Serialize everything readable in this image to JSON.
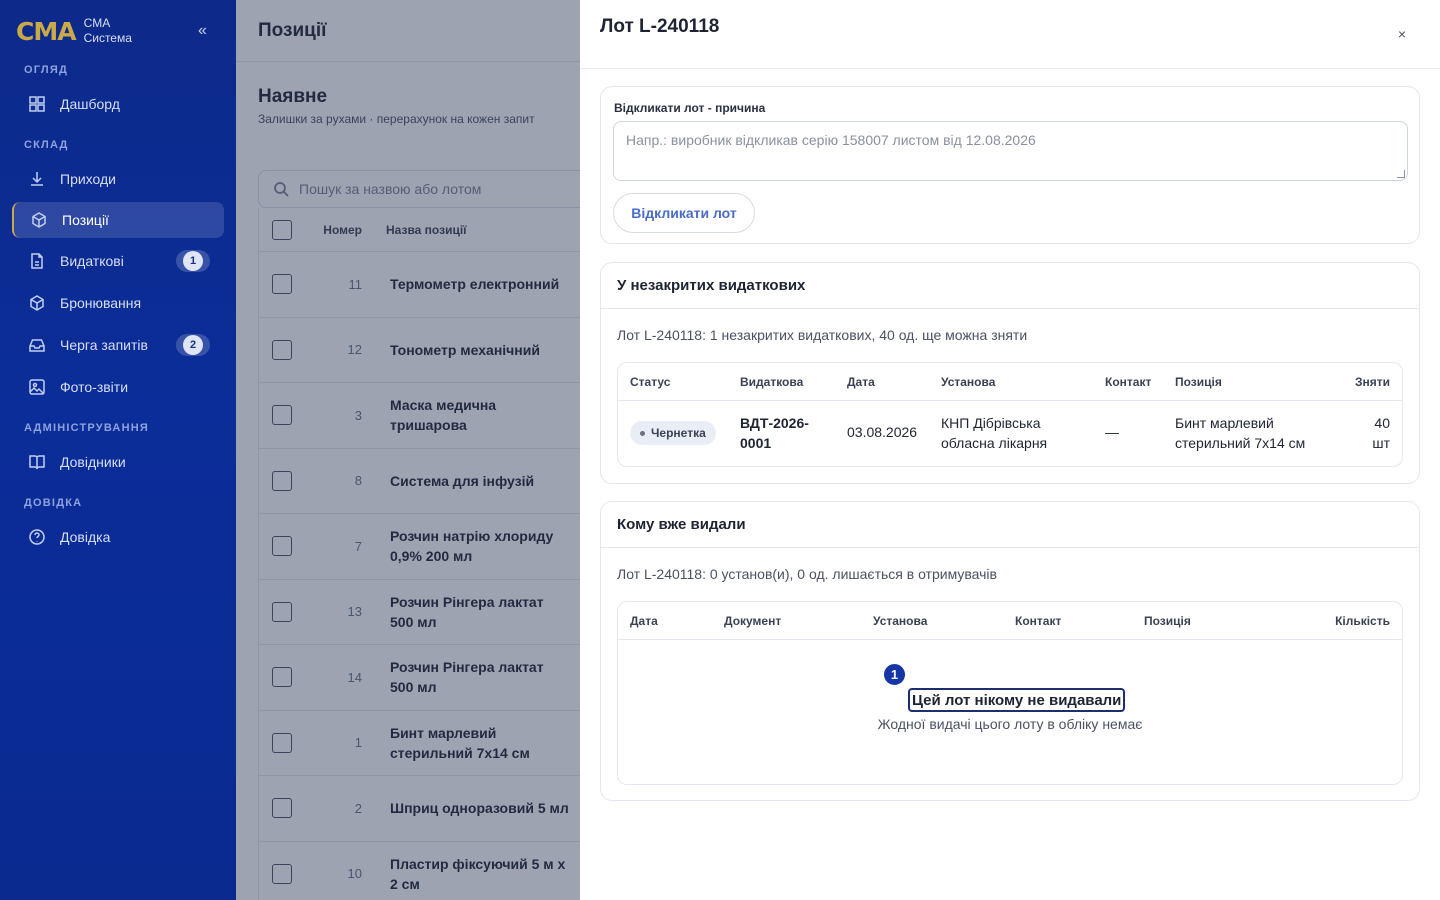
{
  "sidebar": {
    "logo": "CMA",
    "brand_line1": "CMA",
    "brand_line2": "Система",
    "collapse": "«",
    "sections": {
      "overview": "ОГЛЯД",
      "warehouse": "СКЛАД",
      "admin": "АДМІНІСТРУВАННЯ",
      "help": "ДОВІДКА"
    },
    "items": [
      {
        "label": "Дашборд",
        "icon": "dashboard-icon"
      },
      {
        "label": "Приходи",
        "icon": "download-icon"
      },
      {
        "label": "Позиції",
        "icon": "box-icon",
        "active": true
      },
      {
        "label": "Видаткові",
        "icon": "document-icon",
        "badge": "1"
      },
      {
        "label": "Бронювання",
        "icon": "box-icon"
      },
      {
        "label": "Черга запитів",
        "icon": "inbox-icon",
        "badge": "2"
      },
      {
        "label": "Фото-звіти",
        "icon": "image-icon"
      },
      {
        "label": "Довідники",
        "icon": "book-icon"
      },
      {
        "label": "Довідка",
        "icon": "help-icon"
      }
    ]
  },
  "main": {
    "page_title": "Позиції",
    "section_title": "Наявне",
    "section_sub": "Залишки за рухами · перерахунок на кожен запит",
    "search_placeholder": "Пошук за назвою або лотом",
    "columns": {
      "num": "Номер",
      "name": "Назва позиції"
    },
    "rows": [
      {
        "num": "11",
        "name": "Термометр електронний"
      },
      {
        "num": "12",
        "name": "Тонометр механічний"
      },
      {
        "num": "3",
        "name": "Маска медична тришарова"
      },
      {
        "num": "8",
        "name": "Система для інфузій"
      },
      {
        "num": "7",
        "name": "Розчин натрію хлориду 0,9% 200 мл"
      },
      {
        "num": "13",
        "name": "Розчин Рінгера лактат 500 мл"
      },
      {
        "num": "14",
        "name": "Розчин Рінгера лактат 500 мл"
      },
      {
        "num": "1",
        "name": "Бинт марлевий стерильний 7х14 см"
      },
      {
        "num": "2",
        "name": "Шприц одноразовий 5 мл"
      },
      {
        "num": "10",
        "name": "Пластир фіксуючий 5 м х 2 см"
      }
    ]
  },
  "drawer": {
    "title": "Лот L-240118",
    "close": "×",
    "recall": {
      "label": "Відкликати лот - причина",
      "placeholder": "Напр.: виробник відкликав серію 158007 листом від 12.08.2026",
      "button": "Відкликати лот"
    },
    "open": {
      "title": "У незакритих видаткових",
      "desc": "Лот L-240118: 1 незакритих видаткових, 40 од. ще можна зняти",
      "cols": {
        "status": "Статус",
        "doc": "Видаткова",
        "date": "Дата",
        "inst": "Установа",
        "contact": "Контакт",
        "item": "Позиція",
        "qty": "Зняти"
      },
      "row": {
        "status": "Чернетка",
        "doc_l1": "ВДТ-2026-",
        "doc_l2": "0001",
        "date": "03.08.2026",
        "inst_l1": "КНП Дібрівська",
        "inst_l2": "обласна лікарня",
        "contact": "—",
        "item_l1": "Бинт марлевий",
        "item_l2": "стерильний 7х14 см",
        "qty_l1": "40",
        "qty_l2": "шт"
      }
    },
    "issued": {
      "title": "Кому вже видали",
      "desc": "Лот L-240118: 0 установ(и), 0 од. лишається в отримувачів",
      "cols": {
        "date": "Дата",
        "doc": "Документ",
        "inst": "Установа",
        "contact": "Контакт",
        "item": "Позиція",
        "qty": "Кількість"
      },
      "empty_title": "Цей лот нікому не видавали",
      "empty_sub": "Жодної видачі цього лоту в обліку немає",
      "marker": "1"
    }
  }
}
